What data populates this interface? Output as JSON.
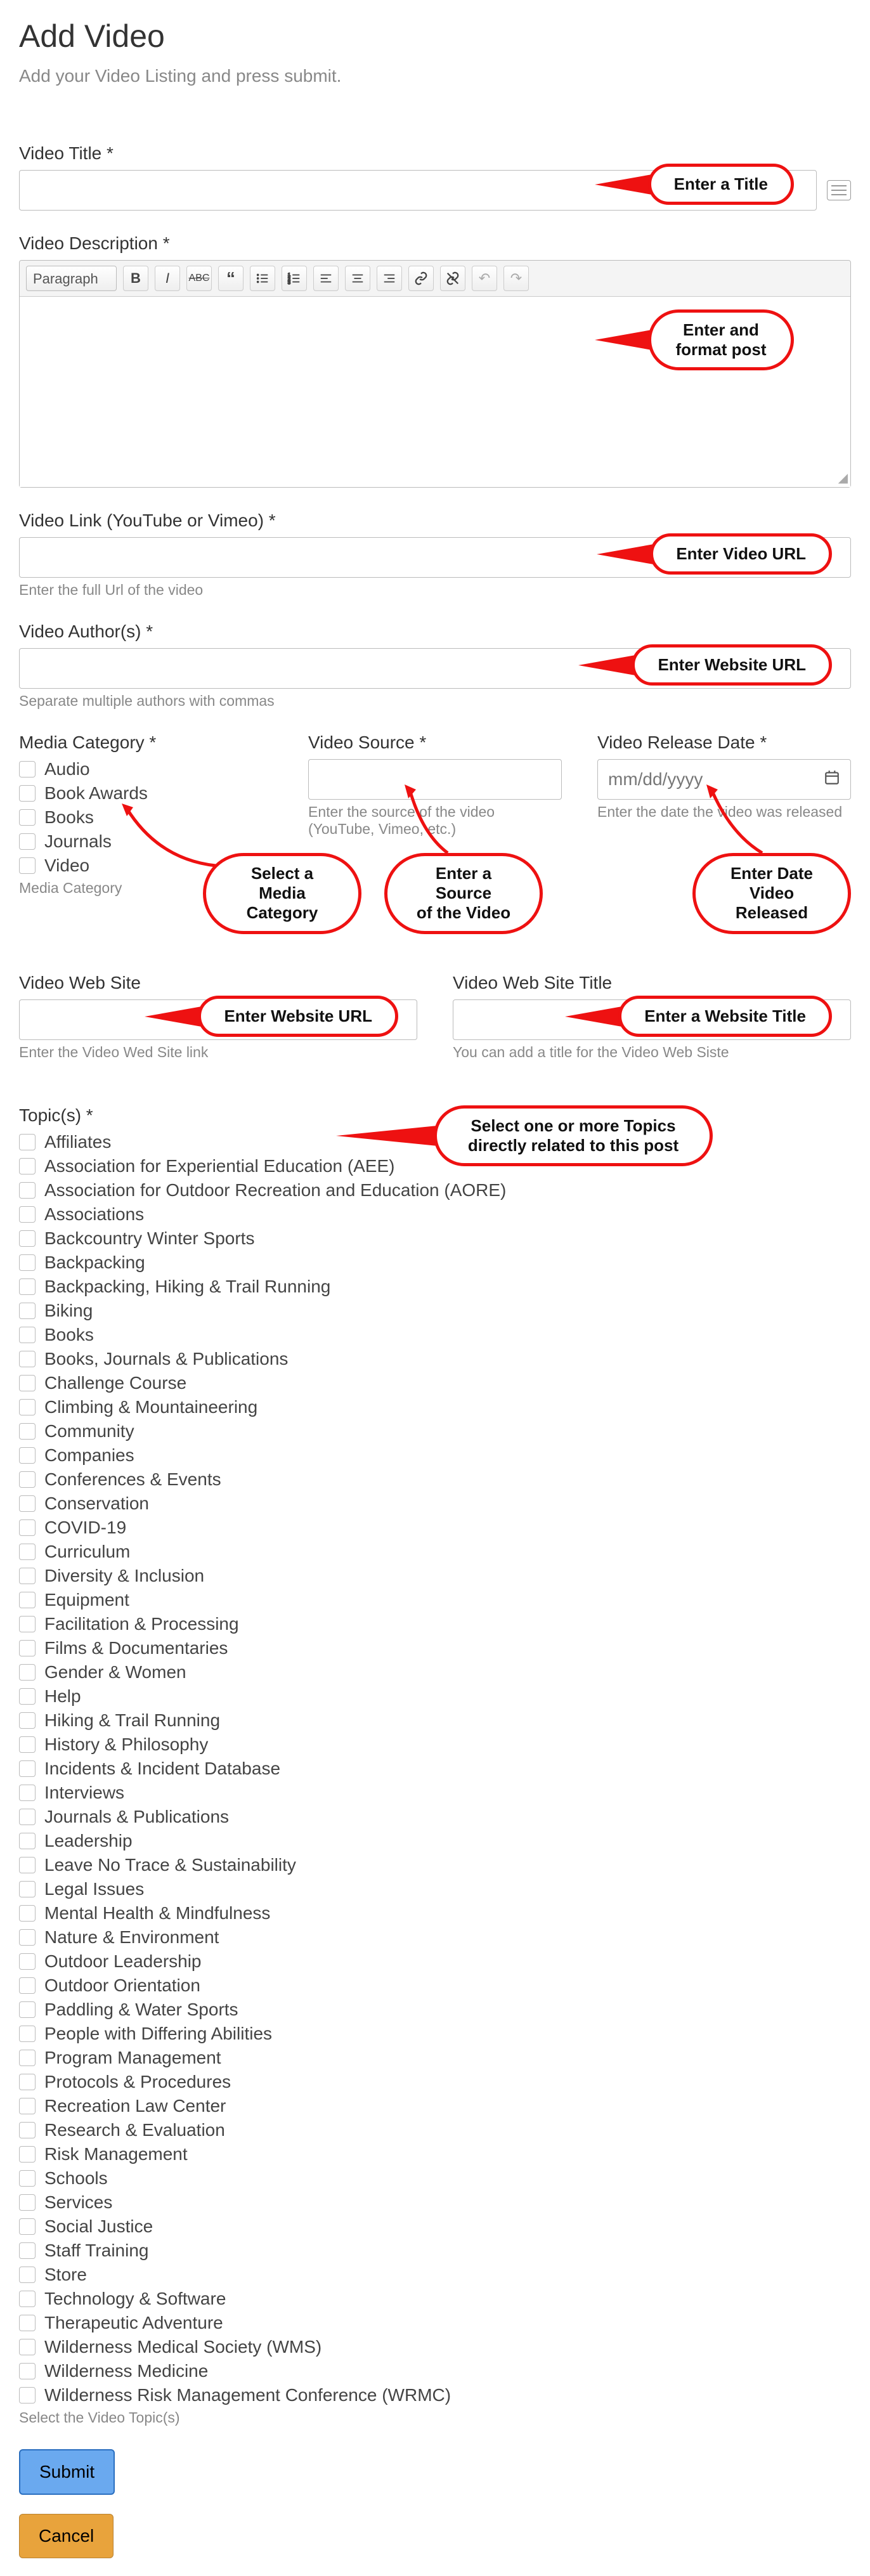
{
  "header": {
    "title": "Add Video",
    "subtitle": "Add your Video Listing and press submit."
  },
  "fields": {
    "video_title": {
      "label": "Video Title *"
    },
    "video_description": {
      "label": "Video Description *",
      "format_select": "Paragraph"
    },
    "video_link": {
      "label": "Video Link (YouTube or Vimeo) *",
      "help": "Enter the full Url of the video"
    },
    "video_authors": {
      "label": "Video Author(s) *",
      "help": "Separate multiple authors with commas"
    },
    "media_category": {
      "label": "Media Category *",
      "options": [
        "Audio",
        "Book Awards",
        "Books",
        "Journals",
        "Video"
      ],
      "help": "Media Category"
    },
    "video_source": {
      "label": "Video Source *",
      "help": "Enter the source of the video (YouTube, Vimeo, etc.)"
    },
    "video_release_date": {
      "label": "Video Release Date *",
      "placeholder": "mm/dd/yyyy",
      "help": "Enter the date the video was released"
    },
    "video_website": {
      "label": "Video Web Site",
      "help": "Enter the Video Wed Site link"
    },
    "video_website_title": {
      "label": "Video Web Site Title",
      "help": "You can add a title for the Video Web Siste"
    },
    "topics": {
      "label": "Topic(s) *",
      "help": "Select the Video Topic(s)",
      "options": [
        "Affiliates",
        "Association for Experiential Education (AEE)",
        "Association for Outdoor Recreation and Education (AORE)",
        "Associations",
        "Backcountry Winter Sports",
        "Backpacking",
        "Backpacking, Hiking & Trail Running",
        "Biking",
        "Books",
        "Books, Journals & Publications",
        "Challenge Course",
        "Climbing & Mountaineering",
        "Community",
        "Companies",
        "Conferences & Events",
        "Conservation",
        "COVID-19",
        "Curriculum",
        "Diversity & Inclusion",
        "Equipment",
        "Facilitation & Processing",
        "Films & Documentaries",
        "Gender & Women",
        "Help",
        "Hiking & Trail Running",
        "History & Philosophy",
        "Incidents & Incident Database",
        "Interviews",
        "Journals & Publications",
        "Leadership",
        "Leave No Trace & Sustainability",
        "Legal Issues",
        "Mental Health & Mindfulness",
        "Nature & Environment",
        "Outdoor Leadership",
        "Outdoor Orientation",
        "Paddling & Water Sports",
        "People with Differing Abilities",
        "Program Management",
        "Protocols & Procedures",
        "Recreation Law Center",
        "Research & Evaluation",
        "Risk Management",
        "Schools",
        "Services",
        "Social Justice",
        "Staff Training",
        "Store",
        "Technology & Software",
        "Therapeutic Adventure",
        "Wilderness Medical Society (WMS)",
        "Wilderness Medicine",
        "Wilderness Risk Management Conference (WRMC)"
      ]
    }
  },
  "callouts": {
    "title": "Enter a Title",
    "desc": "Enter and\nformat post",
    "link": "Enter Video URL",
    "authors": "Enter Website URL",
    "media_cat": "Select a Media\nCategory",
    "source": "Enter a Source\nof the Video",
    "release": "Enter Date\nVideo Released",
    "website": "Enter Website URL",
    "website_title": "Enter a  Website Title",
    "topics": "Select one or more Topics\ndirectly related to this post"
  },
  "buttons": {
    "submit": "Submit",
    "cancel": "Cancel"
  }
}
